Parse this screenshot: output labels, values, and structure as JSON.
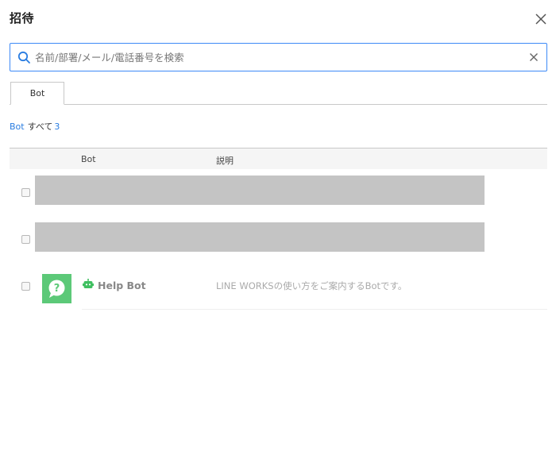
{
  "dialog": {
    "title": "招待"
  },
  "search": {
    "placeholder": "名前/部署/メール/電話番号を検索",
    "value": ""
  },
  "tabs": [
    {
      "label": "Bot",
      "active": true
    }
  ],
  "filter": {
    "category": "Bot",
    "all_label": "すべて",
    "count": "3"
  },
  "table": {
    "columns": {
      "bot": "Bot",
      "description": "説明"
    },
    "rows": [
      {
        "redacted": true,
        "checked": false
      },
      {
        "redacted": true,
        "checked": false
      },
      {
        "redacted": false,
        "checked": false,
        "name": "Help Bot",
        "description": "LINE WORKSの使い方をご案内するBotです。"
      }
    ]
  },
  "colors": {
    "accent": "#2a7de1",
    "search_border": "#3d8af7",
    "avatar_green": "#5cc978",
    "redaction_gray": "#c4c4c4"
  }
}
